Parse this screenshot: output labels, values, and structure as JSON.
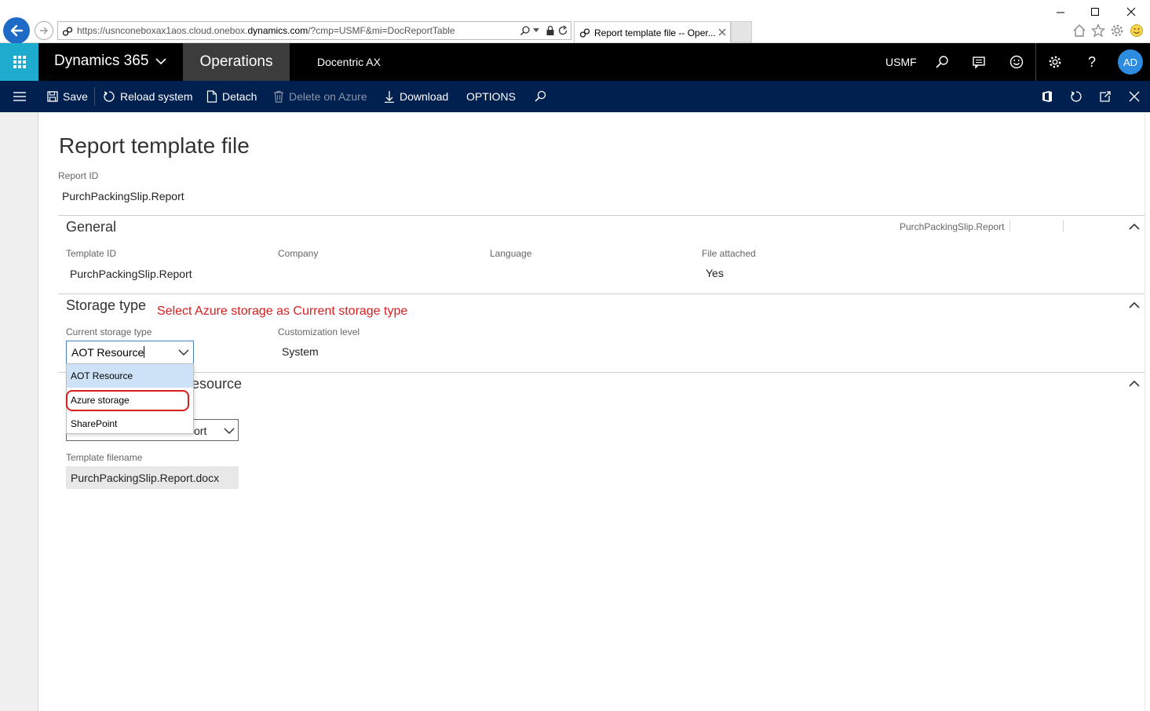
{
  "browser": {
    "url_prefix": "https://usnconeboxax1aos.cloud.onebox.",
    "url_domain": "dynamics.com",
    "url_suffix": "/?cmp=USMF&mi=DocReportTable",
    "tab_title": "Report template file -- Oper..."
  },
  "nav": {
    "product": "Dynamics 365",
    "area": "Operations",
    "module": "Docentric AX",
    "company": "USMF",
    "avatar_initials": "AD"
  },
  "actions": {
    "save": "Save",
    "reload": "Reload system",
    "detach": "Detach",
    "delete_azure": "Delete on Azure",
    "download": "Download",
    "options": "OPTIONS"
  },
  "page": {
    "title": "Report template file",
    "report_id_label": "Report ID",
    "report_id_value": "PurchPackingSlip.Report"
  },
  "general": {
    "title": "General",
    "summary": "PurchPackingSlip.Report",
    "template_id_label": "Template ID",
    "template_id_value": "PurchPackingSlip.Report",
    "company_label": "Company",
    "language_label": "Language",
    "file_attached_label": "File attached",
    "file_attached_value": "Yes"
  },
  "storage": {
    "title": "Storage type",
    "annotation": "Select Azure storage as Current storage type",
    "current_label": "Current storage type",
    "current_value": "AOT Resource",
    "customization_label": "Customization level",
    "customization_value": "System",
    "options": [
      "AOT Resource",
      "Azure storage",
      "SharePoint"
    ]
  },
  "resource": {
    "title_partial": "esource",
    "select_partial": "ort",
    "template_filename_label": "Template filename",
    "template_filename_value": "PurchPackingSlip.Report.docx"
  },
  "colors": {
    "nav_bg": "#000000",
    "waffle_bg": "#1daccd",
    "action_bar_bg": "#002050",
    "annotation": "#d81e1e",
    "avatar_bg": "#2d8ce0"
  }
}
